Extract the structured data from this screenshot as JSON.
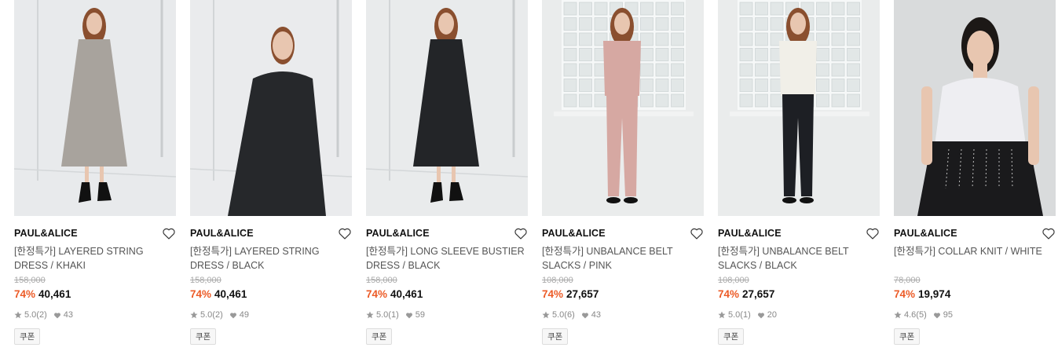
{
  "products": [
    {
      "brand": "PAUL&ALICE",
      "name": "[한정특가] LAYERED STRING DRESS / KHAKI",
      "original_price": "158,000",
      "discount": "74%",
      "price": "40,461",
      "rating": "5.0",
      "reviews": "(2)",
      "likes": "43",
      "coupon": "쿠폰",
      "bg": "#e3e5e6",
      "outfit": "#a8a39d",
      "outfit_style": "dress"
    },
    {
      "brand": "PAUL&ALICE",
      "name": "[한정특가] LAYERED STRING DRESS / BLACK",
      "original_price": "158,000",
      "discount": "74%",
      "price": "40,461",
      "rating": "5.0",
      "reviews": "(2)",
      "likes": "49",
      "coupon": "쿠폰",
      "bg": "#e6e7e8",
      "outfit": "#26282b",
      "outfit_style": "dress-close"
    },
    {
      "brand": "PAUL&ALICE",
      "name": "[한정특가] LONG SLEEVE BUSTIER DRESS / BLACK",
      "original_price": "158,000",
      "discount": "74%",
      "price": "40,461",
      "rating": "5.0",
      "reviews": "(1)",
      "likes": "59",
      "coupon": "쿠폰",
      "bg": "#e4e6e7",
      "outfit": "#232528",
      "outfit_style": "dress"
    },
    {
      "brand": "PAUL&ALICE",
      "name": "[한정특가] UNBALANCE BELT SLACKS / PINK",
      "original_price": "108,000",
      "discount": "74%",
      "price": "27,657",
      "rating": "5.0",
      "reviews": "(6)",
      "likes": "43",
      "coupon": "쿠폰",
      "bg": "#eaecec",
      "outfit": "#d6a8a2",
      "outfit_style": "pants"
    },
    {
      "brand": "PAUL&ALICE",
      "name": "[한정특가] UNBALANCE BELT SLACKS / BLACK",
      "original_price": "108,000",
      "discount": "74%",
      "price": "27,657",
      "rating": "5.0",
      "reviews": "(1)",
      "likes": "20",
      "coupon": "쿠폰",
      "bg": "#eaecec",
      "outfit": "#1d1f24",
      "outfit_style": "pants"
    },
    {
      "brand": "PAUL&ALICE",
      "name": "[한정특가] COLLAR KNIT / WHITE",
      "original_price": "78,000",
      "discount": "74%",
      "price": "19,974",
      "rating": "4.6",
      "reviews": "(5)",
      "likes": "95",
      "coupon": "쿠폰",
      "bg": "#d9dbdc",
      "outfit": "#1a1a1c",
      "outfit_style": "knit"
    }
  ],
  "colors": {
    "discount": "#ec5b27",
    "brand_text": "#111111"
  },
  "icons": {
    "wishlist": "heart-outline-icon",
    "rating": "star-icon",
    "likes": "heart-filled-icon"
  }
}
